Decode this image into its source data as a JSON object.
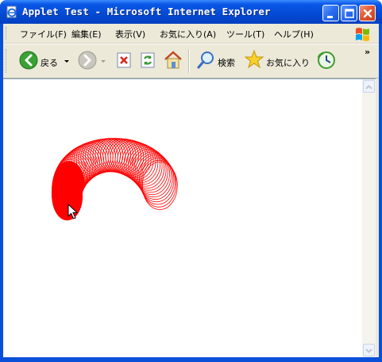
{
  "window": {
    "title": "Applet Test - Microsoft Internet Explorer"
  },
  "menu": [
    {
      "label": "ファイル(F)",
      "name": "menu-file"
    },
    {
      "label": "編集(E)",
      "name": "menu-edit"
    },
    {
      "label": "表示(V)",
      "name": "menu-view"
    },
    {
      "label": "お気に入り(A)",
      "name": "menu-favorites"
    },
    {
      "label": "ツール(T)",
      "name": "menu-tools"
    },
    {
      "label": "ヘルプ(H)",
      "name": "menu-help"
    }
  ],
  "toolbar": {
    "back_label": "戻る",
    "search_label": "検索",
    "favorites_label": "お気に入り",
    "more": "»"
  },
  "applet": {
    "shape_color": "#ff0000",
    "icons": [
      "back-icon",
      "forward-icon",
      "stop-icon",
      "refresh-icon",
      "home-icon",
      "search-icon",
      "favorites-icon",
      "history-icon",
      "mouse-cursor-icon"
    ]
  }
}
